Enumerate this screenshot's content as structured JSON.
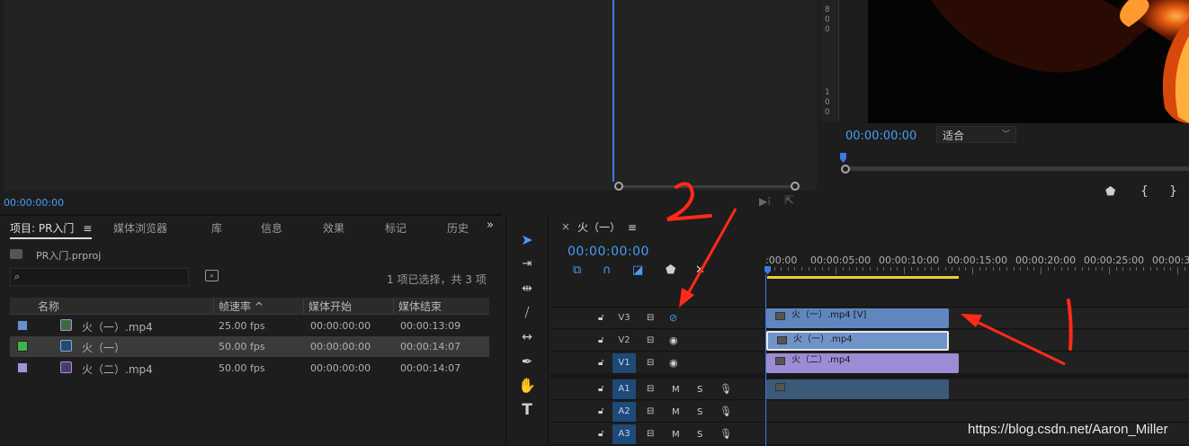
{
  "colors": {
    "accent": "#4a9cf5",
    "clip_video_v3": "#5f86bf",
    "clip_video_v2": "#6f94c8",
    "clip_video_v1": "#9d8bd6",
    "clip_audio": "#3b5a7a",
    "work_area": "#e3d03a",
    "annotation_red": "#ff2a1a"
  },
  "source_monitor": {
    "timecode": "00:00:00:00"
  },
  "program_monitor": {
    "ruler_digits": [
      "8",
      "0",
      "0",
      "1",
      "0",
      "0"
    ],
    "timecode": "00:00:00:00",
    "fit_label": "适合",
    "fit_chevron": "﹀",
    "marker_icon": "marker-icon",
    "in_icon": "mark-in-icon",
    "out_icon": "mark-out-icon"
  },
  "project_panel": {
    "tabs": [
      "项目: PR入门",
      "媒体浏览器",
      "库",
      "信息",
      "效果",
      "标记",
      "历史"
    ],
    "tab_menu": "≡",
    "more": "»",
    "project_file": "PR入门.prproj",
    "search_placeholder": "",
    "selection_status": "1 项已选择，共 3 项",
    "columns": [
      "名称",
      "帧速率 ^",
      "媒体开始",
      "媒体结束"
    ],
    "items": [
      {
        "name": "火（一）.mp4",
        "fps": "25.00 fps",
        "start": "00:00:00:00",
        "end": "00:00:13:09",
        "color": "#6a8fcf",
        "icon": "clip-icon"
      },
      {
        "name": "火（一）",
        "fps": "50.00 fps",
        "start": "00:00:00:00",
        "end": "00:00:14:07",
        "color": "#3fb24a",
        "icon": "sequence-icon"
      },
      {
        "name": "火（二）.mp4",
        "fps": "50.00 fps",
        "start": "00:00:00:00",
        "end": "00:00:14:07",
        "color": "#a58fdc",
        "icon": "clip-icon"
      }
    ]
  },
  "tools": [
    "selection-tool",
    "track-select-tool",
    "ripple-edit-tool",
    "razor-tool",
    "slip-tool",
    "pen-tool",
    "hand-tool",
    "type-tool"
  ],
  "timeline": {
    "close": "×",
    "sequence_name": "火（一）",
    "menu": "≡",
    "timecode": "00:00:00:00",
    "ruler_labels": [
      ":00:00",
      "00:00:05:00",
      "00:00:10:00",
      "00:00:15:00",
      "00:00:20:00",
      "00:00:25:00",
      "00:00:30"
    ],
    "video_tracks": [
      {
        "name": "V3",
        "target": false,
        "eye_hidden": true
      },
      {
        "name": "V2",
        "target": false,
        "eye_hidden": false
      },
      {
        "name": "V1",
        "target": true,
        "eye_hidden": false
      }
    ],
    "audio_tracks": [
      {
        "name": "A1",
        "target": true
      },
      {
        "name": "A2",
        "target": true
      },
      {
        "name": "A3",
        "target": true
      }
    ],
    "track_toggles": {
      "mute": "M",
      "solo": "S"
    },
    "clips": {
      "v3": "火（一）.mp4 [V]",
      "v2": "火（一）.mp4",
      "v1": "火（二）.mp4"
    }
  },
  "annotations": {
    "number_1": "1",
    "number_2": "2"
  },
  "watermark": "https://blog.csdn.net/Aaron_Miller"
}
